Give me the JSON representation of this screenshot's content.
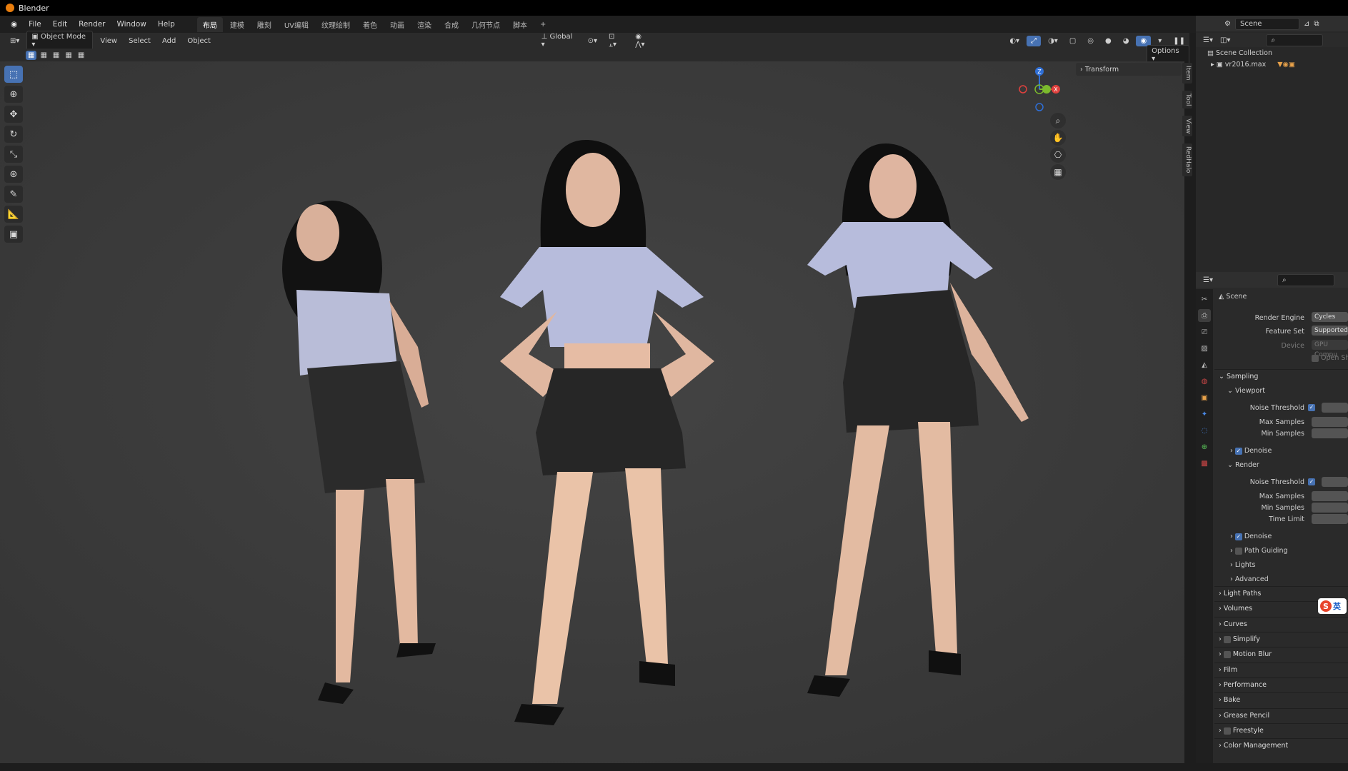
{
  "app": {
    "title": "Blender"
  },
  "menu": [
    "File",
    "Edit",
    "Render",
    "Window",
    "Help"
  ],
  "workspaces": [
    "布局",
    "建模",
    "雕刻",
    "UV编辑",
    "纹理绘制",
    "着色",
    "动画",
    "渲染",
    "合成",
    "几何节点",
    "脚本",
    "+"
  ],
  "viewport_header": {
    "mode": "Object Mode",
    "view": "View",
    "select": "Select",
    "add": "Add",
    "object": "Object",
    "orientation": "Global",
    "options": "Options"
  },
  "gizmo": {
    "z": "Z",
    "y": "Y",
    "x": "X"
  },
  "n_panel": {
    "transform": "Transform",
    "tabs": [
      "Item",
      "Tool",
      "View",
      "RedHalo"
    ]
  },
  "outliner": {
    "scene_name": "Scene",
    "collection": "Scene Collection",
    "item": "vr2016.max"
  },
  "properties": {
    "scene_label": "Scene",
    "render_engine_label": "Render Engine",
    "render_engine_value": "Cycles",
    "feature_set_label": "Feature Set",
    "feature_set_value": "Supported",
    "device_label": "Device",
    "device_value": "GPU Compu",
    "open_shading": "Open Shac",
    "sampling": "Sampling",
    "viewport": "Viewport",
    "noise_threshold": "Noise Threshold",
    "max_samples": "Max Samples",
    "min_samples": "Min Samples",
    "denoise": "Denoise",
    "render": "Render",
    "time_limit": "Time Limit",
    "path_guiding": "Path Guiding",
    "lights": "Lights",
    "advanced": "Advanced",
    "sections": [
      "Light Paths",
      "Volumes",
      "Curves",
      "Simplify",
      "Motion Blur",
      "Film",
      "Performance",
      "Bake",
      "Grease Pencil",
      "Freestyle",
      "Color Management"
    ]
  },
  "ime_badge": "英",
  "colors": {
    "accent": "#4772b3",
    "viewport_bg": "#3b3b3b",
    "panel_bg": "#2a2a2a",
    "orange": "#e87d0d"
  }
}
